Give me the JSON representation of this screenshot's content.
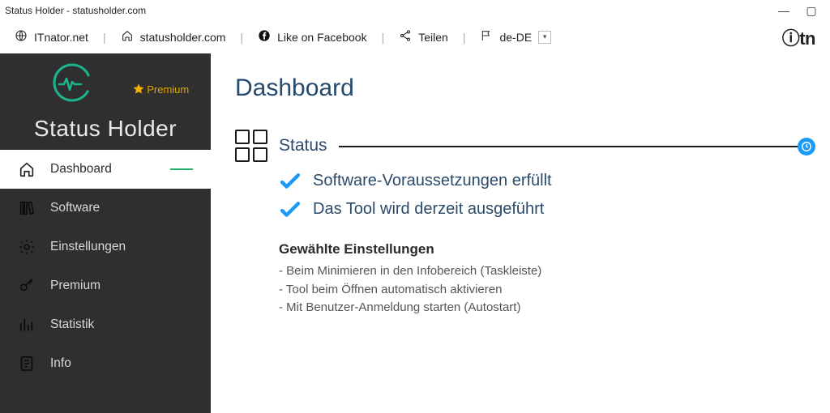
{
  "window": {
    "title": "Status Holder - statusholder.com",
    "minimize": "—",
    "maximize": "▢"
  },
  "topbar": {
    "link1": "ITnator.net",
    "link2": "statusholder.com",
    "link3": "Like on Facebook",
    "link4": "Teilen",
    "lang": "de-DE",
    "brand": "ⓘtn"
  },
  "sidebar": {
    "premium": "Premium",
    "app_title": "Status Holder",
    "items": [
      {
        "label": "Dashboard"
      },
      {
        "label": "Software"
      },
      {
        "label": "Einstellungen"
      },
      {
        "label": "Premium"
      },
      {
        "label": "Statistik"
      },
      {
        "label": "Info"
      }
    ]
  },
  "page": {
    "title": "Dashboard",
    "status_title": "Status",
    "status_items": [
      "Software-Voraussetzungen erfüllt",
      "Das Tool wird derzeit ausgeführt"
    ],
    "settings_heading": "Gewählte Einstellungen",
    "settings_items": [
      "- Beim Minimieren in den Infobereich (Taskleiste)",
      "- Tool beim Öffnen automatisch aktivieren",
      "- Mit Benutzer-Anmeldung starten (Autostart)"
    ]
  }
}
